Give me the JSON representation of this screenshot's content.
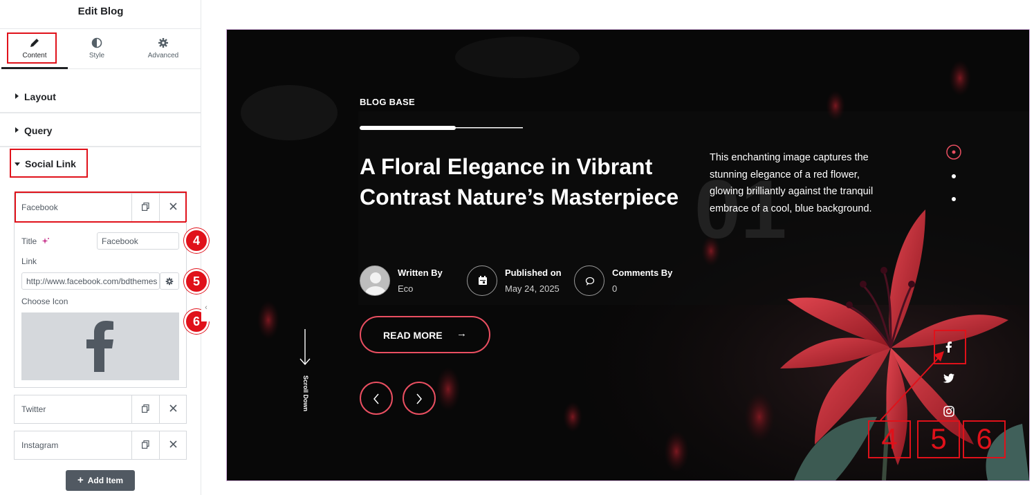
{
  "sidebar": {
    "title": "Edit Blog",
    "tabs": [
      {
        "label": "Content",
        "icon": "pencil-icon"
      },
      {
        "label": "Style",
        "icon": "contrast-icon"
      },
      {
        "label": "Advanced",
        "icon": "gear-icon"
      }
    ],
    "sections": {
      "layout": "Layout",
      "query": "Query",
      "social_link": "Social Link"
    },
    "repeater": {
      "items": [
        "Facebook",
        "Twitter",
        "Instagram"
      ],
      "title_label": "Title",
      "title_value": "Facebook",
      "link_label": "Link",
      "link_value": "http://www.facebook.com/bdthemes",
      "choose_icon_label": "Choose Icon",
      "chosen_icon": "facebook-icon"
    },
    "add_item_label": "Add Item",
    "badges": [
      "4",
      "5",
      "6"
    ]
  },
  "preview": {
    "category": "BLOG BASE",
    "headline": "A Floral Elegance in Vibrant Contrast Nature’s Masterpiece",
    "description": "This enchanting image captures the stunning elegance of a red flower, glowing brilliantly against the tranquil embrace of a cool, blue background.",
    "slide_number": "01",
    "meta": [
      {
        "label": "Written By",
        "value": "Eco",
        "icon": "avatar-icon"
      },
      {
        "label": "Published on",
        "value": "May 24, 2025",
        "icon": "calendar-icon"
      },
      {
        "label": "Comments By",
        "value": "0",
        "icon": "comment-icon"
      }
    ],
    "read_more": "READ MORE",
    "scroll_down": "Scroll Down",
    "social_icons": [
      "facebook-icon",
      "twitter-icon",
      "instagram-icon"
    ],
    "annotation_numbers": [
      "4",
      "5",
      "6"
    ],
    "progress": 0.59,
    "accent": "#ea4f61",
    "annotation_color": "#e0111a"
  }
}
